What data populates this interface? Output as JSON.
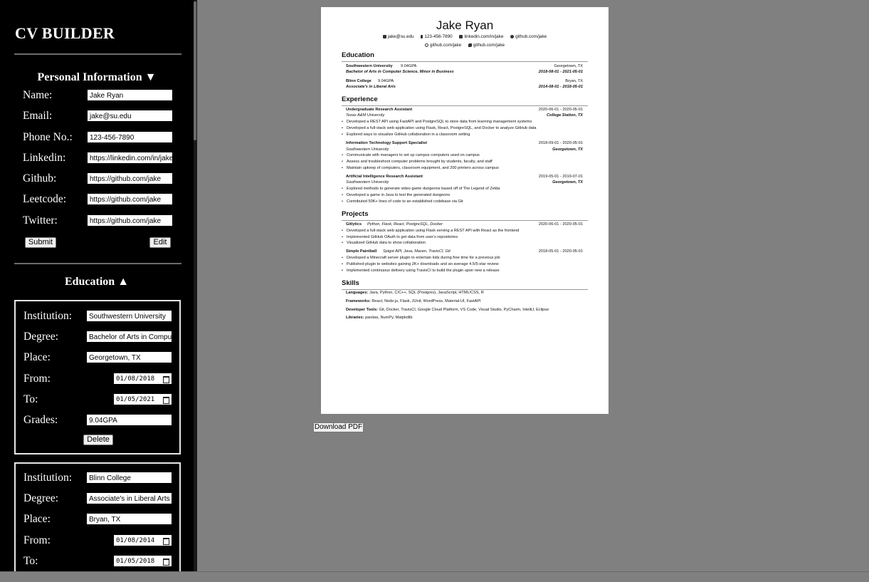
{
  "app": {
    "title": "CV BUILDER"
  },
  "personal": {
    "heading": "Personal Information ▼",
    "fields": [
      {
        "label": "Name:",
        "value": "Jake Ryan"
      },
      {
        "label": "Email:",
        "value": "jake@su.edu"
      },
      {
        "label": "Phone No.:",
        "value": "123-456-7890"
      },
      {
        "label": "Linkedin:",
        "value": "https://linkedin.com/in/jake"
      },
      {
        "label": "Github:",
        "value": "https://github.com/jake"
      },
      {
        "label": "Leetcode:",
        "value": "https://github.com/jake"
      },
      {
        "label": "Twitter:",
        "value": "https://github.com/jake"
      }
    ],
    "submit_label": "Submit",
    "edit_label": "Edit"
  },
  "education_form": {
    "heading": "Education ▲",
    "labels": {
      "institution": "Institution:",
      "degree": "Degree:",
      "place": "Place:",
      "from": "From:",
      "to": "To:",
      "grades": "Grades:"
    },
    "delete_label": "Delete",
    "entries": [
      {
        "institution": "Southwestern University",
        "degree": "Bachelor of Arts in Computer",
        "place": "Georgetown, TX",
        "from": "01/08/2018",
        "to": "01/05/2021",
        "grades": "9.04GPA"
      },
      {
        "institution": "Blinn College",
        "degree": "Associate's in Liberal Arts",
        "place": "Bryan, TX",
        "from": "01/08/2014",
        "to": "01/05/2018"
      }
    ]
  },
  "preview": {
    "name": "Jake Ryan",
    "contacts_line1": [
      "jake@su.edu",
      "123-456-7890",
      "linkedin.com/in/jake",
      "github.com/jake"
    ],
    "contacts_line2": [
      "github.com/jake",
      "github.com/jake"
    ],
    "sections": {
      "education": "Education",
      "experience": "Experience",
      "projects": "Projects",
      "skills": "Skills"
    },
    "education": [
      {
        "school": "Southwestern University",
        "grade": "9.04GPA",
        "place": "Georgetown, TX",
        "degree": "Bachelor of Arts in Computer Science, Minor in Business",
        "dates": "2018-08-01   -   2021-05-01"
      },
      {
        "school": "Blinn College",
        "grade": "9.04GPA",
        "place": "Bryan, TX",
        "degree": "Associate's in Liberal Arts",
        "dates": "2014-08-01   -   2018-05-01"
      }
    ],
    "experience": [
      {
        "title": "Undergraduate Research Assistant",
        "dates": "2020-06-01   -   2020-05-01",
        "org": "Texas A&M University",
        "place": "College Station, TX",
        "bullets": [
          "Developed a REST API using FastAPI and PostgreSQL to store data from learning management systems",
          "Developed a full-stack web application using Flask, React, PostgreSQL, and Docker to analyze GitHub data",
          "Explored ways to visualize GitHub collaboration in a classroom setting"
        ]
      },
      {
        "title": "Information Technology Support Specialist",
        "dates": "2018-09-01   -   2020-05-01",
        "org": "Southwestern University",
        "place": "Georgetown, TX",
        "bullets": [
          "Communicate with managers to set up campus computers used on campus",
          "Assess and troubleshoot computer problems brought by students, faculty, and staff",
          "Maintain upkeep of computers, classroom equipment, and 200 printers across campus"
        ]
      },
      {
        "title": "Artificial Intelligence Research Assistant",
        "dates": "2019-05-01   -   2019-07-01",
        "org": "Southwestern University",
        "place": "Georgetown, TX",
        "bullets": [
          "Explored methods to generate video game dungeons based off of The Legend of Zelda",
          "Developed a game in Java to test the generated dungeons",
          "Contributed 50K+ lines of code to an established codebase via Git"
        ]
      }
    ],
    "projects": [
      {
        "name": "Gitlytics",
        "tech": "Python, Flask, React, PostgreSQL, Docker",
        "dates": "2020-06-01   -   2020-05-01",
        "bullets": [
          "Developed a full-stack web application using Flask serving a REST API with React as the frontend",
          "Implemented GitHub OAuth to get data from user's repositories",
          "Visualized GitHub data to show collaboration"
        ]
      },
      {
        "name": "Simple Paintball",
        "tech": "Spigot API, Java, Maven, TravisCI, Git",
        "dates": "2018-05-01   -   2020-05-01",
        "bullets": [
          "Developed a Minecraft server plugin to entertain kids during free time for a previous job",
          "Published plugin to websites gaining 2K+ downloads and an average 4.5/5-star review",
          "Implemented continuous delivery using TravisCI to build the plugin upon new a release"
        ]
      }
    ],
    "skills": [
      {
        "label": "Languages:",
        "value": "Java, Python, C/C++, SQL (Postgres), JavaScript, HTML/CSS, R"
      },
      {
        "label": "Frameworks:",
        "value": "React, Node.js, Flask, JUnit, WordPress, Material-UI, FastAPI"
      },
      {
        "label": "Developer Tools:",
        "value": "Git, Docker, TravisCI, Google Cloud Platform, VS Code, Visual Studio, PyCharm, IntelliJ, Eclipse"
      },
      {
        "label": "Libraries:",
        "value": "pandas, NumPy, Matplotlib"
      }
    ]
  },
  "download_label": "Download PDF"
}
